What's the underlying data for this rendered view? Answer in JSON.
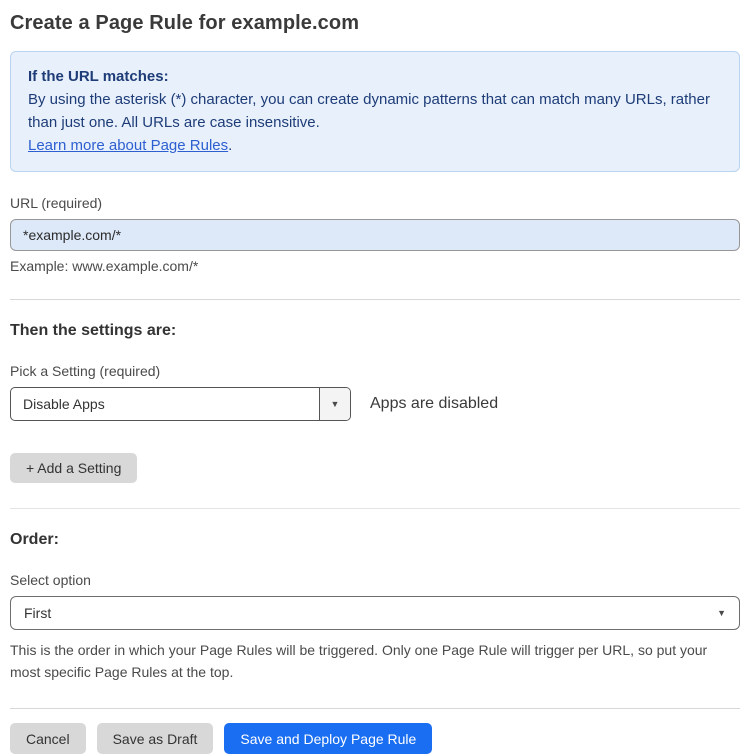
{
  "page": {
    "title": "Create a Page Rule for example.com"
  },
  "info_box": {
    "heading": "If the URL matches:",
    "body": "By using the asterisk (*) character, you can create dynamic patterns that can match many URLs, rather than just one. All URLs are case insensitive.",
    "link_label": "Learn more about Page Rules",
    "link_suffix": "."
  },
  "url_field": {
    "label": "URL (required)",
    "value": "*example.com/*",
    "helper": "Example: www.example.com/*"
  },
  "settings_section": {
    "heading": "Then the settings are:",
    "setting_label": "Pick a Setting (required)",
    "setting_value": "Disable Apps",
    "setting_status": "Apps are disabled",
    "add_setting_label": "+ Add a Setting"
  },
  "order_section": {
    "heading": "Order:",
    "select_label": "Select option",
    "select_value": "First",
    "helper": "This is the order in which your Page Rules will be triggered. Only one Page Rule will trigger per URL, so put your most specific Page Rules at the top."
  },
  "footer": {
    "cancel_label": "Cancel",
    "save_draft_label": "Save as Draft",
    "save_deploy_label": "Save and Deploy Page Rule"
  },
  "icons": {
    "dropdown_arrow": "▼"
  },
  "colors": {
    "accent_blue": "#1a6ef2",
    "info_background": "#e8f1fb",
    "info_border": "#b9d3f0",
    "info_text": "#1e3c78",
    "link_blue": "#2d5fd0",
    "url_input_background": "#dde9f8",
    "neutral_button_gray": "#d8d8d8"
  }
}
